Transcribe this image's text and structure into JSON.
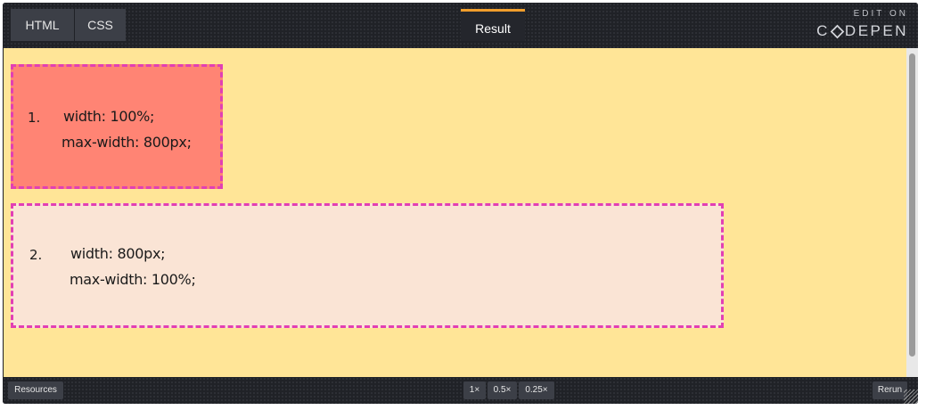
{
  "tabs": {
    "html": "HTML",
    "css": "CSS",
    "result": "Result"
  },
  "branding": {
    "edit_on": "EDIT ON",
    "logo_left": "C",
    "logo_right": "DEPEN"
  },
  "result": {
    "box1": {
      "number": "1.",
      "line1": "width: 100%;",
      "line2": "max-width: 800px;"
    },
    "box2": {
      "number": "2.",
      "line1": "width: 800px;",
      "line2": "max-width: 100%;"
    }
  },
  "bottom": {
    "resources": "Resources",
    "zoom_1x": "1×",
    "zoom_05x": "0.5×",
    "zoom_025x": "0.25×",
    "rerun": "Rerun"
  },
  "colors": {
    "accent": "#f19e2c",
    "result_bg": "#ffe597",
    "box1_bg": "#ff8474",
    "box2_bg": "#fae4d5",
    "border_dashed": "#e23fb4"
  }
}
